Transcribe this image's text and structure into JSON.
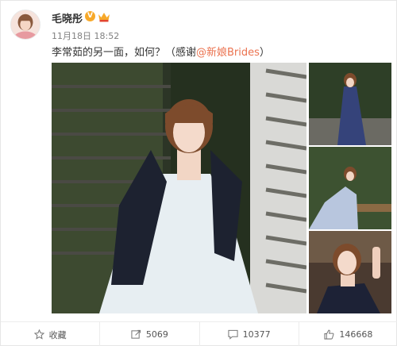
{
  "post": {
    "username": "毛晓彤",
    "verified_badge": "V",
    "timestamp": "11月18日 18:52",
    "text_before": "李常茹的另一面，如何？（感谢",
    "mention": "@新娘Brides",
    "text_after": "）"
  },
  "icons": {
    "verified": "verified-v-icon",
    "member": "crown-icon",
    "favorite": "star-icon",
    "repost": "repost-icon",
    "comment": "comment-icon",
    "like": "thumbs-up-icon"
  },
  "actions": {
    "favorite_label": "收藏",
    "repost_count": "5069",
    "comment_count": "10377",
    "like_count": "146668"
  },
  "colors": {
    "mention": "#eb7350",
    "verified": "#f7a92a"
  }
}
